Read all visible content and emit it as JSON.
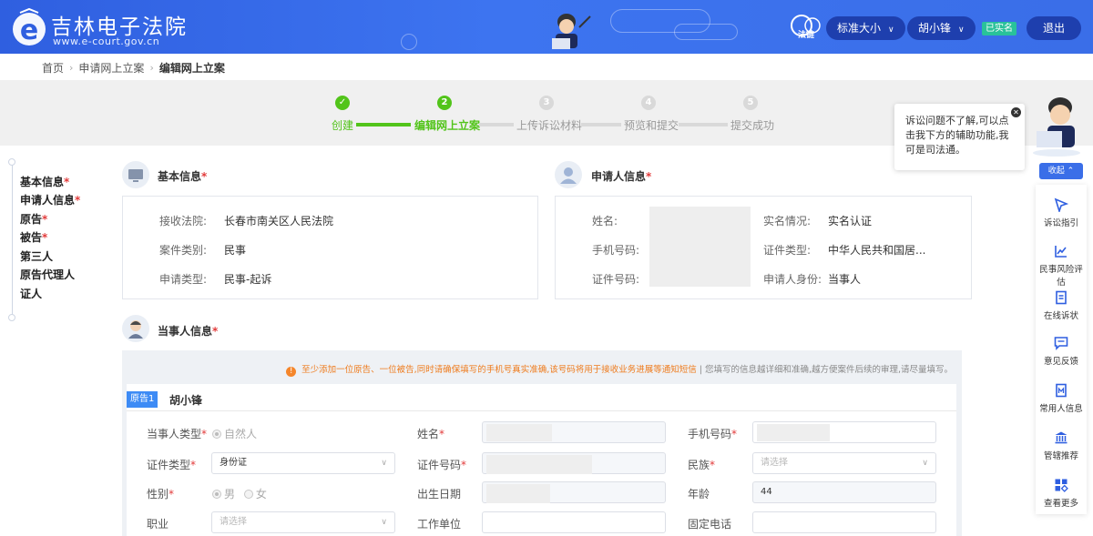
{
  "header": {
    "title": "吉林电子法院",
    "url": "www.e-court.gov.cn",
    "fazhi_label": "法链",
    "font_size_select": "标准大小",
    "user_name": "胡小锋",
    "verified_badge": "已实名",
    "logout": "退出"
  },
  "breadcrumb": {
    "home": "首页",
    "apply": "申请网上立案",
    "current": "编辑网上立案"
  },
  "steps": [
    {
      "num": "✓",
      "label": "创建",
      "state": "done"
    },
    {
      "num": "2",
      "label": "编辑网上立案",
      "state": "active"
    },
    {
      "num": "3",
      "label": "上传诉讼材料",
      "state": "todo"
    },
    {
      "num": "4",
      "label": "预览和提交",
      "state": "todo"
    },
    {
      "num": "5",
      "label": "提交成功",
      "state": "todo"
    }
  ],
  "left_nav": [
    {
      "label": "基本信息",
      "required": "*"
    },
    {
      "label": "申请人信息",
      "required": "*"
    },
    {
      "label": "原告",
      "required": "*"
    },
    {
      "label": "被告",
      "required": "*"
    },
    {
      "label": "第三人",
      "required": ""
    },
    {
      "label": "原告代理人",
      "required": ""
    },
    {
      "label": "证人",
      "required": ""
    }
  ],
  "basic_info": {
    "title": "基本信息",
    "required": "*",
    "court_label": "接收法院:",
    "court_value": "长春市南关区人民法院",
    "case_type_label": "案件类别:",
    "case_type_value": "民事",
    "apply_type_label": "申请类型:",
    "apply_type_value": "民事-起诉"
  },
  "applicant_info": {
    "title": "申请人信息",
    "required": "*",
    "name_label": "姓名:",
    "phone_label": "手机号码:",
    "id_label": "证件号码:",
    "realname_label": "实名情况:",
    "realname_value": "实名认证",
    "id_type_label": "证件类型:",
    "id_type_value": "中华人民共和国居...",
    "identity_label": "申请人身份:",
    "identity_value": "当事人"
  },
  "party_info": {
    "title": "当事人信息",
    "required": "*",
    "notice_main": "至少添加一位原告、一位被告,同时请确保填写的手机号真实准确,该号码将用于接收业务进展等通知短信",
    "notice_extra": " | 您填写的信息越详细和准确,越方便案件后续的审理,请尽量填写。",
    "tab_badge": "原告1",
    "tab_name": "胡小锋",
    "fields": {
      "party_type_label": "当事人类型",
      "party_type_value": "自然人",
      "name_label": "姓名",
      "mobile_label": "手机号码",
      "id_type_label": "证件类型",
      "id_type_value": "身份证",
      "id_no_label": "证件号码",
      "ethnic_label": "民族",
      "ethnic_placeholder": "请选择",
      "gender_label": "性别",
      "gender_male": "男",
      "gender_female": "女",
      "birth_label": "出生日期",
      "age_label": "年龄",
      "age_value": "44",
      "job_label": "职业",
      "job_placeholder": "请选择",
      "work_label": "工作单位",
      "phone_label": "固定电话"
    }
  },
  "assistant": {
    "tooltip": "诉讼问题不了解,可以点击我下方的辅助功能,我可是司法通。",
    "collapse": "收起",
    "items": [
      {
        "label": "诉讼指引",
        "icon": "cursor-icon"
      },
      {
        "label": "民事风险评估",
        "icon": "chart-icon"
      },
      {
        "label": "在线诉状",
        "icon": "document-icon"
      },
      {
        "label": "意见反馈",
        "icon": "message-icon"
      },
      {
        "label": "常用人信息",
        "icon": "contact-icon"
      },
      {
        "label": "管辖推荐",
        "icon": "court-icon"
      },
      {
        "label": "查看更多",
        "icon": "grid-icon"
      }
    ]
  }
}
